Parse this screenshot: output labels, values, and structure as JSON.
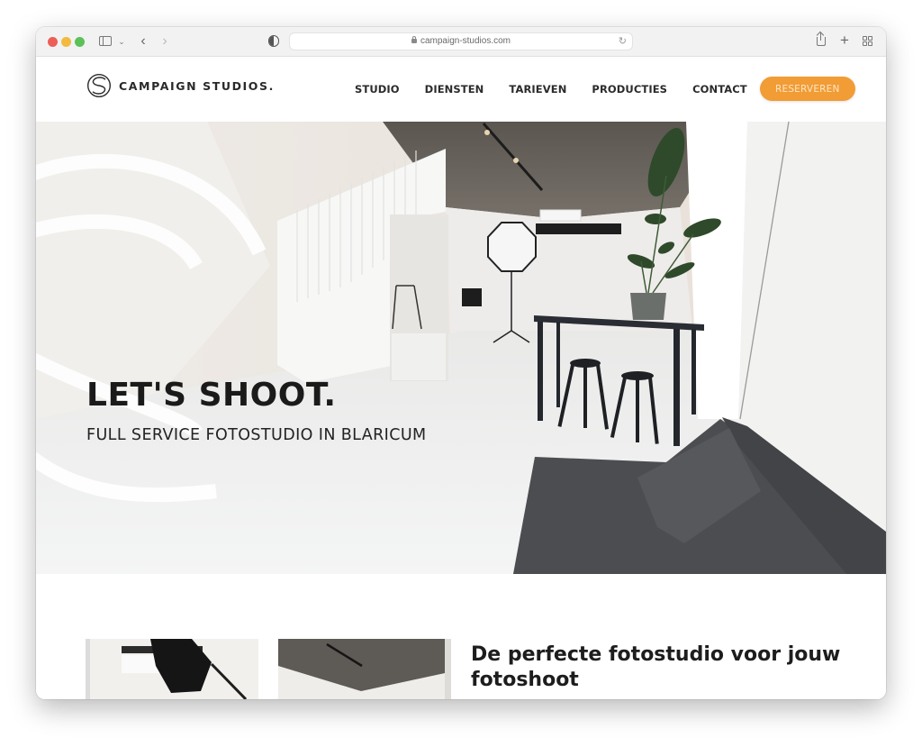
{
  "browser": {
    "url": "campaign-studios.com",
    "controls": {
      "close": "close-window",
      "minimize": "minimize-window",
      "zoom": "zoom-window",
      "back_icon": "‹",
      "forward_icon": "›",
      "chevron_icon": "⌄",
      "reload_icon": "↻",
      "newtab_icon": "+"
    }
  },
  "site": {
    "logo_text": "CAMPAIGN STUDIOS.",
    "nav": [
      {
        "label": "STUDIO"
      },
      {
        "label": "DIENSTEN"
      },
      {
        "label": "TARIEVEN"
      },
      {
        "label": "PRODUCTIES"
      },
      {
        "label": "CONTACT"
      }
    ],
    "cta_label": "RESERVEREN",
    "accent_color": "#f29c35"
  },
  "hero": {
    "title": "LET'S SHOOT.",
    "subtitle": "FULL SERVICE FOTOSTUDIO IN BLARICUM"
  },
  "intro": {
    "title": "De perfecte fotostudio voor jouw fotoshoot"
  }
}
